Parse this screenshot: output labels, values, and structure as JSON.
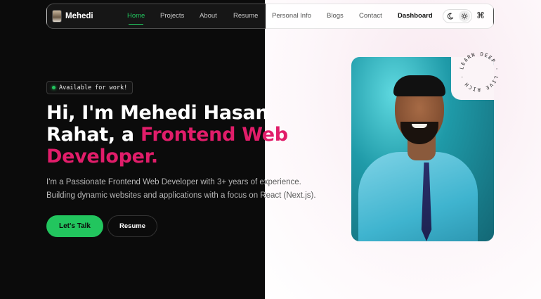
{
  "brand": {
    "name": "Mehedi"
  },
  "nav": {
    "items": [
      {
        "label": "Home",
        "active": true
      },
      {
        "label": "Projects"
      },
      {
        "label": "About"
      },
      {
        "label": "Resume"
      },
      {
        "label": "Personal Info"
      },
      {
        "label": "Blogs"
      },
      {
        "label": "Contact"
      },
      {
        "label": "Dashboard",
        "bold": true
      }
    ],
    "theme_icons": [
      "moon-icon",
      "sun-icon"
    ],
    "command_icon": "command-icon",
    "command_glyph": "⌘"
  },
  "hero": {
    "badge": "Available for work!",
    "headline": {
      "line1": "Hi, I'm Mehedi Hasan",
      "line2_white": "Rahat, a ",
      "line2_pink": "Frontend Web",
      "line3_pink": "Developer."
    },
    "description": {
      "line1": "I'm a Passionate Frontend Web Developer with 3+ years of experience.",
      "line2": "Building dynamic websites and applications with a focus on React (Next.js)."
    },
    "cta_primary": "Let's Talk",
    "cta_secondary": "Resume"
  },
  "photo": {
    "circular_text": "LEARN DEEP · LIVE RICH ·"
  },
  "colors": {
    "accent_green": "#22c55e",
    "accent_pink": "#e11d6a",
    "dark_bg": "#0b0b0b",
    "light_bg": "#fbf4f7"
  }
}
